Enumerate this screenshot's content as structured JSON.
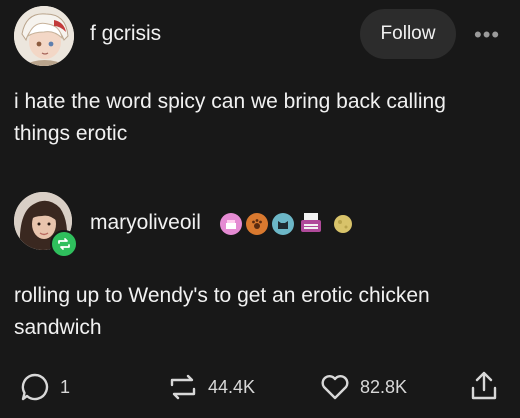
{
  "post": {
    "author": "f gcrisis",
    "follow_label": "Follow",
    "more_label": "•••",
    "text": "i hate the word spicy can we bring back calling things erotic"
  },
  "reblog": {
    "author": "maryoliveoil",
    "text": "rolling up to Wendy's to get an erotic chicken sandwich",
    "badge_icons": [
      "cake-badge-icon",
      "paw-badge-icon",
      "cat-badge-icon",
      "typewriter-badge-icon",
      "moon-badge-icon"
    ]
  },
  "actions": {
    "replies": "1",
    "reblogs": "44.4K",
    "likes": "82.8K"
  },
  "colors": {
    "background": "#181818",
    "button_bg": "#2c2c2c",
    "reblog_green": "#2fbf5d",
    "badge_pink": "#e58bd3",
    "badge_orange": "#d9792f",
    "badge_teal": "#6cb7c7"
  }
}
